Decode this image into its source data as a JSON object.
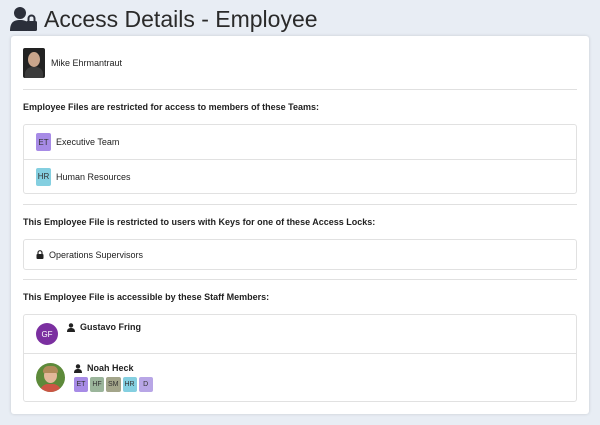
{
  "header": {
    "title": "Access Details - Employee",
    "icon": "user-lock-icon"
  },
  "employee": {
    "name": "Mike Ehrmantraut"
  },
  "teams_section": {
    "title": "Employee Files are restricted for access to members of these Teams:",
    "teams": [
      {
        "abbr": "ET",
        "name": "Executive Team",
        "color": "#a78be6"
      },
      {
        "abbr": "HR",
        "name": "Human Resources",
        "color": "#84cfe0"
      }
    ]
  },
  "locks_section": {
    "title": "This Employee File is restricted to users with Keys for one of these Access Locks:",
    "locks": [
      {
        "name": "Operations Supervisors",
        "icon": "lock-icon"
      }
    ]
  },
  "staff_section": {
    "title": "This Employee File is accessible by these Staff Members:",
    "members": [
      {
        "initials": "GF",
        "name": "Gustavo Fring",
        "avatar_color": "#7b2fa0",
        "tags": []
      },
      {
        "name": "Noah Heck",
        "tags": [
          {
            "label": "ET",
            "color": "#a78be6"
          },
          {
            "label": "HF",
            "color": "#9bb59b"
          },
          {
            "label": "SM",
            "color": "#a3a58a"
          },
          {
            "label": "HR",
            "color": "#84cfe0"
          },
          {
            "label": "D",
            "color": "#b8a6e6"
          }
        ]
      }
    ]
  }
}
